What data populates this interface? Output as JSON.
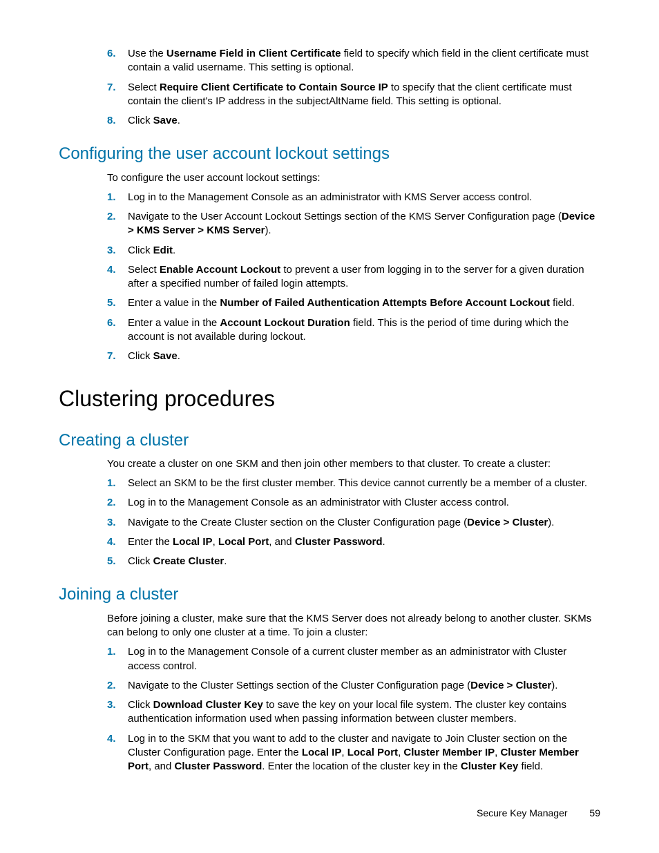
{
  "topList": {
    "items": [
      {
        "num": "6.",
        "pre": "Use the ",
        "b1": "Username Field in Client Certificate",
        "post": " field to specify which field in the client certificate must contain a valid username. This setting is optional."
      },
      {
        "num": "7.",
        "pre": "Select ",
        "b1": "Require Client Certificate to Contain Source IP",
        "post": " to specify that the client certificate must contain the client's IP address in the subjectAltName field. This setting is optional."
      },
      {
        "num": "8.",
        "pre": "Click ",
        "b1": "Save",
        "post": "."
      }
    ]
  },
  "h2a": "Configuring the user account lockout settings",
  "introA": "To configure the user account lockout settings:",
  "listA": [
    {
      "num": "1.",
      "text": "Log in to the Management Console as an administrator with KMS Server access control."
    },
    {
      "num": "2.",
      "pre": "Navigate to the User Account Lockout Settings section of the KMS Server Configuration page (",
      "b1": "Device > KMS Server > KMS Server",
      "post": ")."
    },
    {
      "num": "3.",
      "pre": "Click ",
      "b1": "Edit",
      "post": "."
    },
    {
      "num": "4.",
      "pre": "Select ",
      "b1": "Enable Account Lockout",
      "post": " to prevent a user from logging in to the server for a given duration after a specified number of failed login attempts."
    },
    {
      "num": "5.",
      "pre": "Enter a value in the ",
      "b1": "Number of Failed Authentication Attempts Before Account Lockout",
      "post": " field."
    },
    {
      "num": "6.",
      "pre": "Enter a value in the ",
      "b1": "Account Lockout Duration",
      "post": " field. This is the period of time during which the account is not available during lockout."
    },
    {
      "num": "7.",
      "pre": "Click ",
      "b1": "Save",
      "post": "."
    }
  ],
  "h1": "Clustering procedures",
  "h2b": "Creating a cluster",
  "introB": "You create a cluster on one SKM and then join other members to that cluster. To create a cluster:",
  "listB": [
    {
      "num": "1.",
      "text": "Select an SKM to be the first cluster member. This device cannot currently be a member of a cluster."
    },
    {
      "num": "2.",
      "text": "Log in to the Management Console as an administrator with Cluster access control."
    },
    {
      "num": "3.",
      "pre": "Navigate to the Create Cluster section on the Cluster Configuration page (",
      "b1": "Device > Cluster",
      "post": ")."
    },
    {
      "num": "4.",
      "pre": "Enter the ",
      "b1": "Local IP",
      "mid1": ", ",
      "b2": "Local Port",
      "mid2": ", and ",
      "b3": "Cluster Password",
      "post": "."
    },
    {
      "num": "5.",
      "pre": "Click ",
      "b1": "Create Cluster",
      "post": "."
    }
  ],
  "h2c": "Joining a cluster",
  "introC": "Before joining a cluster, make sure that the KMS Server does not already belong to another cluster. SKMs can belong to only one cluster at a time. To join a cluster:",
  "listC": [
    {
      "num": "1.",
      "text": "Log in to the Management Console of a current cluster member as an administrator with Cluster access control."
    },
    {
      "num": "2.",
      "pre": "Navigate to the Cluster Settings section of the Cluster Configuration page (",
      "b1": "Device > Cluster",
      "post": ")."
    },
    {
      "num": "3.",
      "pre": "Click ",
      "b1": "Download Cluster Key",
      "post": " to save the key on your local file system. The cluster key contains authentication information used when passing information between cluster members."
    },
    {
      "num": "4.",
      "pre": "Log in to the SKM that you want to add to the cluster and navigate to Join Cluster section on the Cluster Configuration page. Enter the ",
      "b1": "Local IP",
      "mid1": ", ",
      "b2": "Local Port",
      "mid2": ", ",
      "b3": "Cluster Member IP",
      "mid3": ", ",
      "b4": "Cluster Member Port",
      "mid4": ", and ",
      "b5": "Cluster Password",
      "post2": ". Enter the location of the cluster key in the ",
      "b6": "Cluster Key",
      "post": " field."
    }
  ],
  "footer": {
    "title": "Secure Key Manager",
    "page": "59"
  }
}
